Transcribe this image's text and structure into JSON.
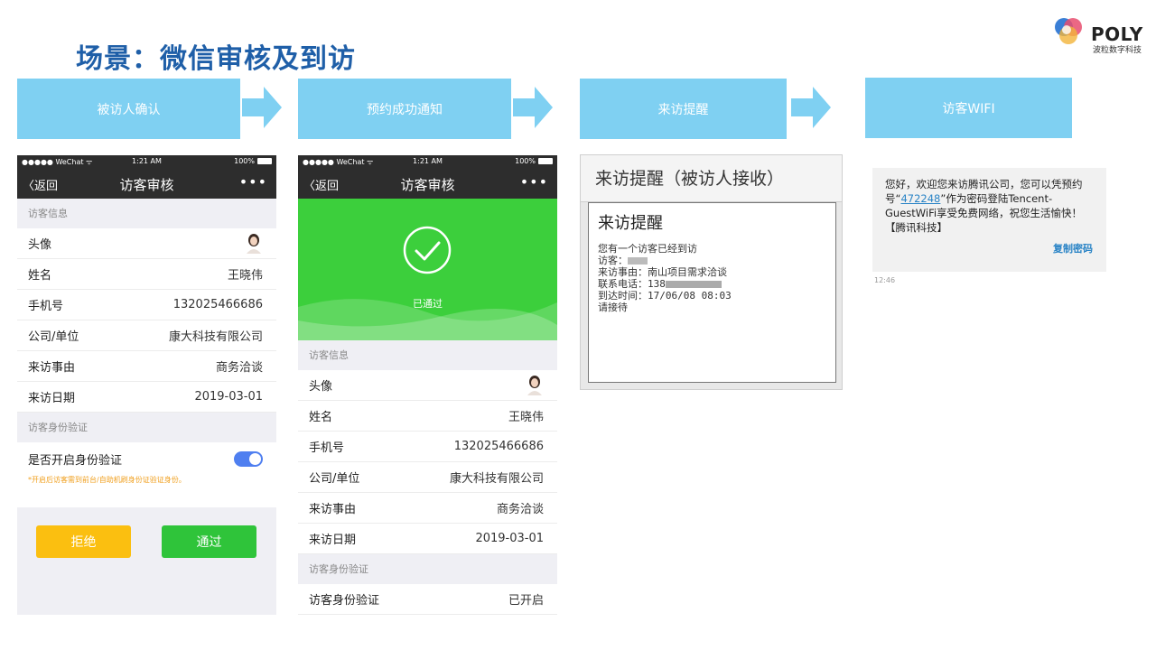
{
  "page_title": "场景：微信审核及到访",
  "brand": {
    "name": "POLY",
    "sub": "波粒数字科技"
  },
  "steps": [
    "被访人确认",
    "预约成功通知",
    "来访提醒",
    "访客WIFI"
  ],
  "colors": {
    "step_bg": "#7fd0f2",
    "title": "#1f5fa8",
    "success_green": "#3ccf3c",
    "reject": "#fbbf10",
    "approve": "#2fc43a",
    "toggle": "#4f7ff0"
  },
  "phone1": {
    "status": {
      "carrier": "●●●●● WeChat ᯤ",
      "time": "1:21 AM",
      "battery": "100%"
    },
    "nav": {
      "back": "〈返回",
      "title": "访客审核",
      "more": "•••"
    },
    "section_info": "访客信息",
    "rows": [
      {
        "label": "头像",
        "value": ""
      },
      {
        "label": "姓名",
        "value": "王晓伟"
      },
      {
        "label": "手机号",
        "value": "132025466686"
      },
      {
        "label": "公司/单位",
        "value": "康大科技有限公司"
      },
      {
        "label": "来访事由",
        "value": "商务洽谈"
      },
      {
        "label": "来访日期",
        "value": "2019-03-01"
      }
    ],
    "section_verify": "访客身份验证",
    "verify_label": "是否开启身份验证",
    "verify_on": true,
    "hint": "*开启后访客需到前台/自助机刷身份证验证身份。",
    "reject_label": "拒绝",
    "approve_label": "通过"
  },
  "phone2": {
    "status": {
      "carrier": "●●●●● WeChat ᯤ",
      "time": "1:21 AM",
      "battery": "100%"
    },
    "nav": {
      "back": "〈返回",
      "title": "访客审核",
      "more": "•••"
    },
    "passed_label": "已通过",
    "section_info": "访客信息",
    "rows": [
      {
        "label": "头像",
        "value": ""
      },
      {
        "label": "姓名",
        "value": "王晓伟"
      },
      {
        "label": "手机号",
        "value": "132025466686"
      },
      {
        "label": "公司/单位",
        "value": "康大科技有限公司"
      },
      {
        "label": "来访事由",
        "value": "商务洽谈"
      },
      {
        "label": "来访日期",
        "value": "2019-03-01"
      }
    ],
    "section_verify": "访客身份验证",
    "verify_label": "访客身份验证",
    "verify_value": "已开启"
  },
  "reminder": {
    "header": "来访提醒（被访人接收）",
    "card_title": "来访提醒",
    "line1": "您有一个访客已经到访",
    "line2_label": "访客：",
    "line3": "来访事由：南山项目需求洽谈",
    "line4_label": "联系电话：138",
    "line5": "到达时间：17/06/08 08:03",
    "line6": "请接待"
  },
  "sms": {
    "text_before": "您好，欢迎您来访腾讯公司，您可以凭预约号“",
    "code": "472248",
    "text_after": "”作为密码登陆Tencent-GuestWiFi享受免费网络，祝您生活愉快！【腾讯科技】",
    "copy_label": "复制密码",
    "time": "12:46"
  }
}
